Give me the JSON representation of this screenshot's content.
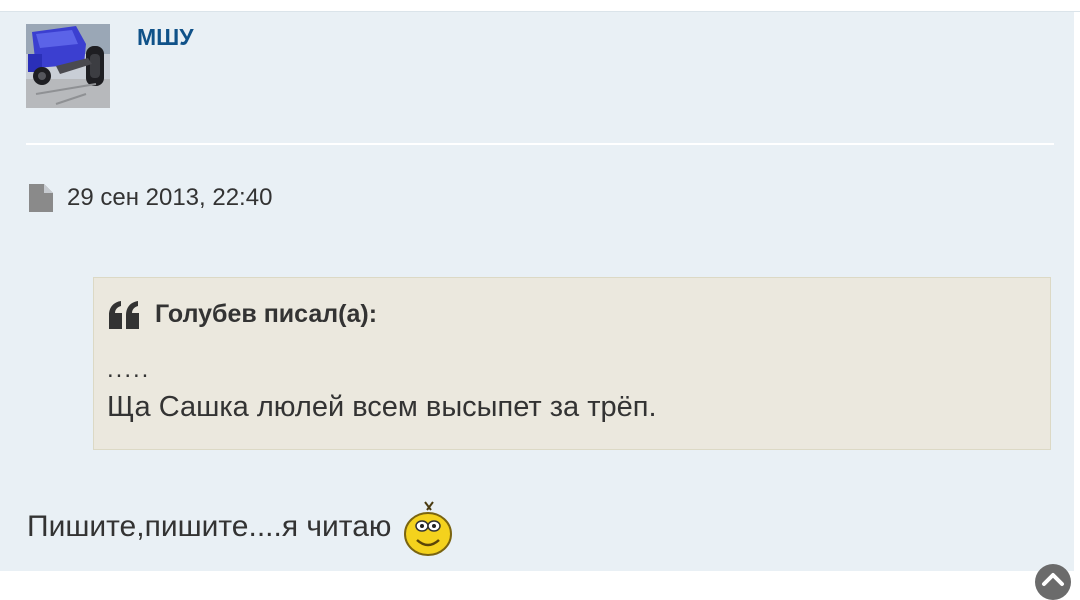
{
  "post": {
    "author": "МШУ",
    "avatar_icon": "avatar-photo-truck",
    "date": "29 сен 2013, 22:40",
    "quote": {
      "author_line": "Голубев писал(а):",
      "line1": ".....",
      "line2": "Ща Сашка люлей всем высыпет за трёп."
    },
    "message": "Пишите,пишите....я читаю",
    "smiley_icon": "reading-smiley-icon"
  },
  "colors": {
    "background": "#e9f0f5",
    "author": "#105289",
    "text": "#333333",
    "quote_bg": "#ebe8de",
    "quote_border": "#dcd9c5"
  }
}
